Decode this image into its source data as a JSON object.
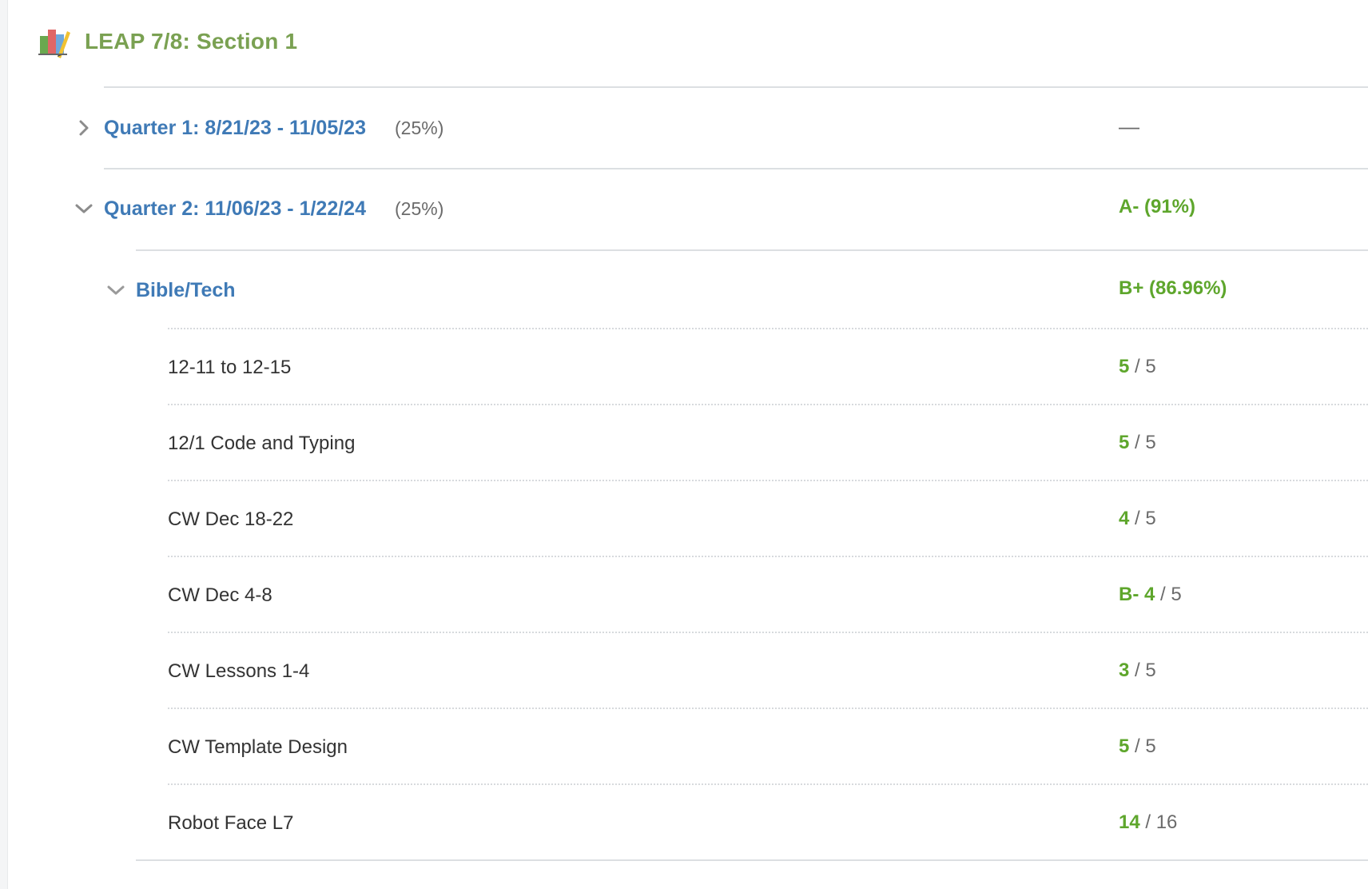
{
  "course": {
    "title": "LEAP 7/8: Section 1",
    "icon": "gradebook-chart-icon"
  },
  "periods": [
    {
      "title": "Quarter 1: 8/21/23 - 11/05/23",
      "weight": "(25%)",
      "grade": "—",
      "expanded": false
    },
    {
      "title": "Quarter 2: 11/06/23 - 1/22/24",
      "weight": "(25%)",
      "grade": "A- (91%)",
      "expanded": true,
      "categories": [
        {
          "title": "Bible/Tech",
          "grade": "B+ (86.96%)",
          "expanded": true,
          "items": [
            {
              "title": "12-11 to 12-15",
              "score": "5",
              "total": "/ 5"
            },
            {
              "title": "12/1 Code and Typing",
              "score": "5",
              "total": "/ 5"
            },
            {
              "title": "CW Dec 18-22",
              "score": "4",
              "total": "/ 5"
            },
            {
              "title": "CW Dec 4-8",
              "score": "B- 4",
              "total": "/ 5"
            },
            {
              "title": "CW Lessons 1-4",
              "score": "3",
              "total": "/ 5"
            },
            {
              "title": "CW Template Design",
              "score": "5",
              "total": "/ 5"
            },
            {
              "title": "Robot Face L7",
              "score": "14",
              "total": "/ 16"
            }
          ]
        }
      ]
    }
  ],
  "colors": {
    "course_title": "#7aa152",
    "link_blue": "#3f7ab6",
    "grade_green": "#5ea62c",
    "muted_gray": "#6b6b6b",
    "item_text": "#333333"
  }
}
